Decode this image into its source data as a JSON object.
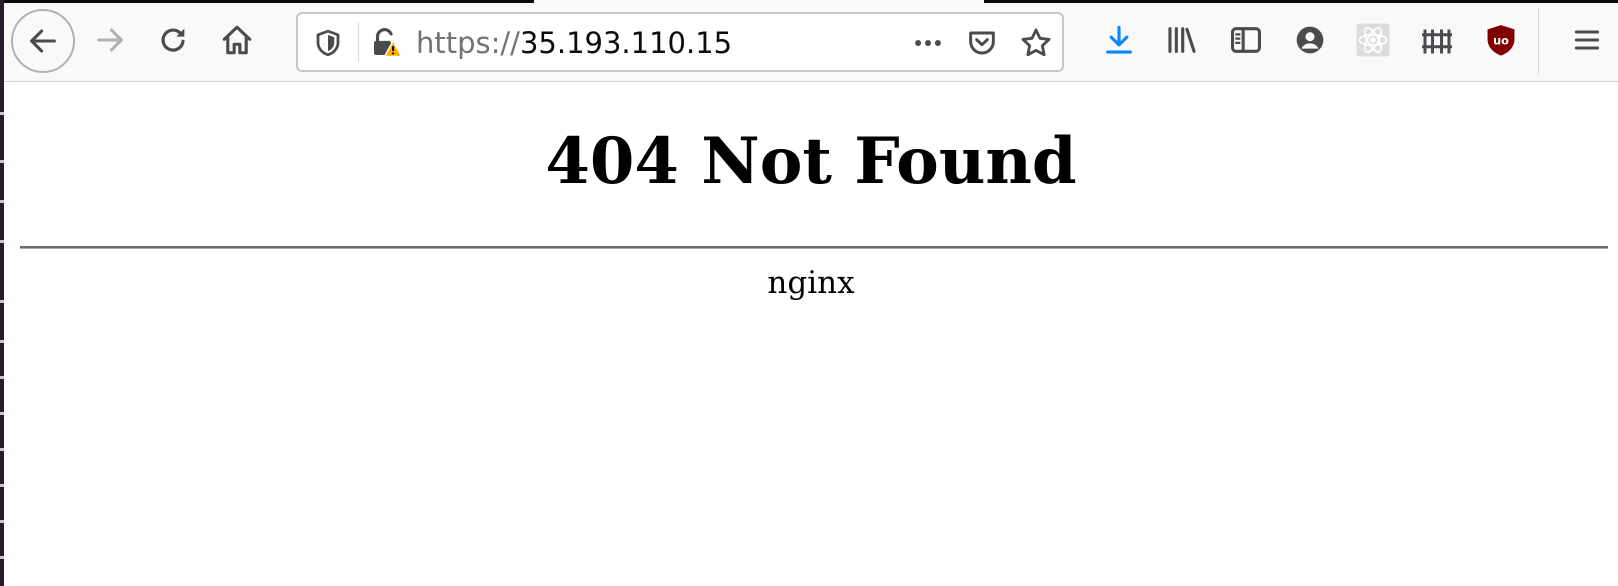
{
  "browser": {
    "url": {
      "scheme": "https://",
      "host": "35.193.110.15"
    },
    "colors": {
      "toolbar_bg": "#f9f9fa",
      "icon": "#4a4a4f",
      "icon_disabled": "#b1b1b3",
      "download_accent": "#0a84ff",
      "warning": "#ffb000",
      "ublock_red": "#800000"
    },
    "icons": [
      "back-arrow-icon",
      "forward-arrow-icon",
      "reload-icon",
      "home-icon",
      "tracking-protection-shield-icon",
      "insecure-lock-warning-icon",
      "page-actions-ellipsis-icon",
      "pocket-icon",
      "bookmark-star-icon",
      "downloads-arrow-icon",
      "library-icon",
      "sidebar-icon",
      "account-icon",
      "react-devtools-icon",
      "fence-extension-icon",
      "ublock-origin-icon",
      "hamburger-menu-icon"
    ]
  },
  "page": {
    "heading": "404 Not Found",
    "server": "nginx"
  }
}
